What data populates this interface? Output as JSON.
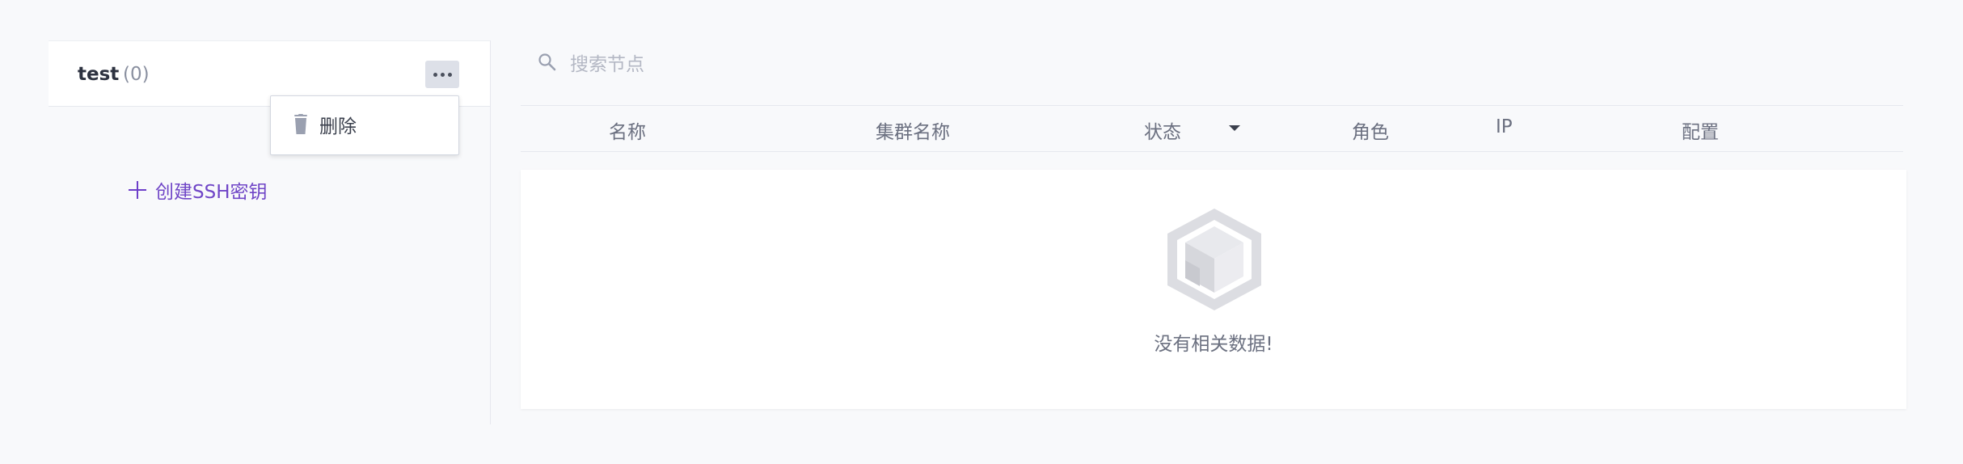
{
  "group": {
    "name": "test",
    "count": "(0)"
  },
  "dropdown": {
    "delete_label": "删除"
  },
  "create_key": {
    "label": "创建SSH密钥"
  },
  "search": {
    "placeholder": "搜索节点"
  },
  "table": {
    "columns": [
      "名称",
      "集群名称",
      "状态",
      "角色",
      "IP",
      "配置"
    ],
    "rows": [],
    "empty_text": "没有相关数据!"
  },
  "colors": {
    "accent": "#7046c7",
    "background": "#f8f9fb"
  },
  "icons": {
    "more": "more-dots-icon",
    "delete": "trash-icon",
    "add": "plus-icon",
    "search": "search-icon",
    "empty": "empty-box-icon",
    "sort": "caret-down-icon"
  }
}
